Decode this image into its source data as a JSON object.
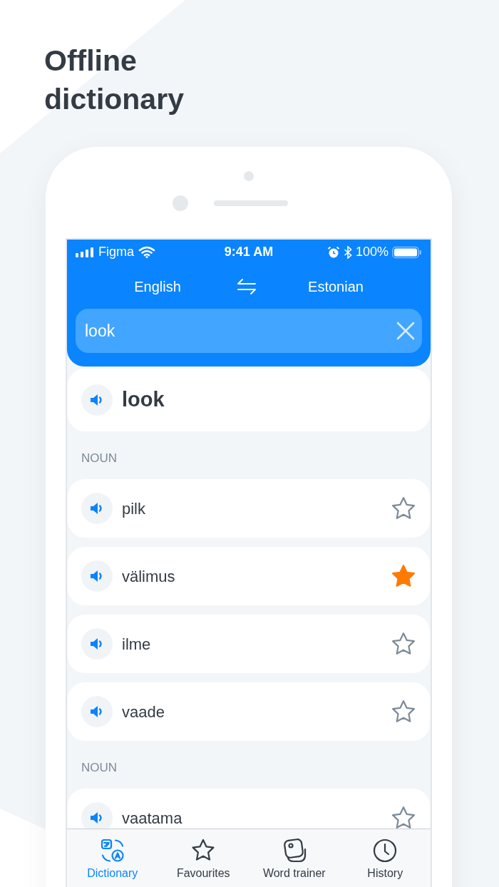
{
  "headline": "Offline dictionary",
  "status_bar": {
    "carrier": "Figma",
    "time": "9:41 AM",
    "battery": "100%"
  },
  "languages": {
    "source": "English",
    "target": "Estonian"
  },
  "search": {
    "value": "look"
  },
  "headword": "look",
  "sections": [
    {
      "label": "NOUN",
      "entries": [
        {
          "word": "pilk",
          "favourite": false
        },
        {
          "word": "välimus",
          "favourite": true
        },
        {
          "word": "ilme",
          "favourite": false
        },
        {
          "word": "vaade",
          "favourite": false
        }
      ]
    },
    {
      "label": "NOUN",
      "entries": [
        {
          "word": "vaatama",
          "favourite": false
        }
      ]
    }
  ],
  "tabs": [
    {
      "label": "Dictionary",
      "selected": true
    },
    {
      "label": "Favourites",
      "selected": false
    },
    {
      "label": "Word trainer",
      "selected": false
    },
    {
      "label": "History",
      "selected": false
    }
  ]
}
